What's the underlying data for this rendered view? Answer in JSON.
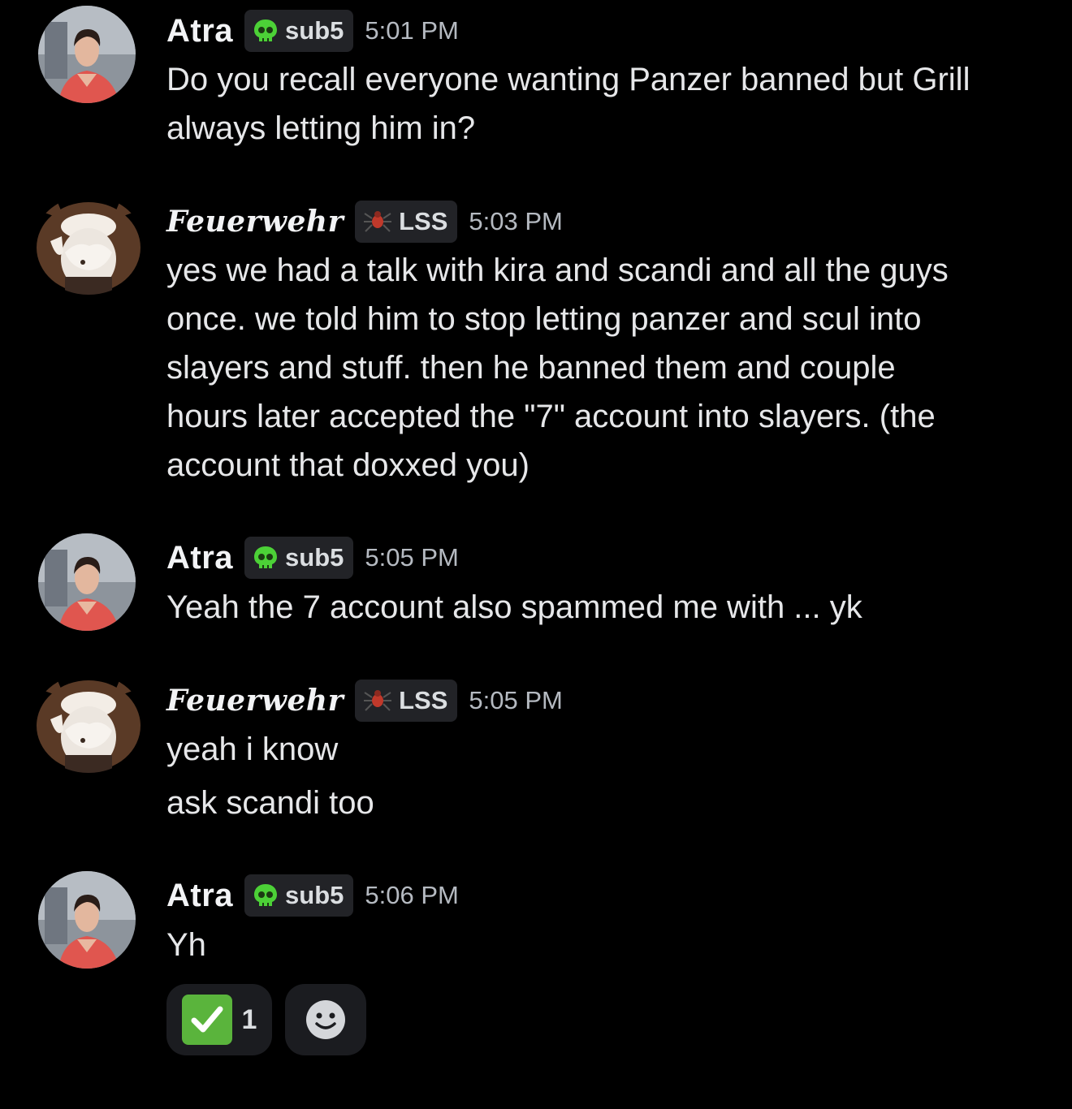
{
  "colors": {
    "background": "#000000",
    "username": "#f2f3f5",
    "timestamp": "#b5bac1",
    "tag_bg": "#222327",
    "sub5_icon": "#4cd137",
    "lss_icon": "#c0392b",
    "check": "#5ab43c"
  },
  "messages": [
    {
      "author": "Atra",
      "tag": {
        "icon": "skull-icon",
        "label": "sub5"
      },
      "time": "5:01 PM",
      "lines": [
        "Do you recall everyone wanting Panzer banned but Grill\nalways letting him in?"
      ]
    },
    {
      "author": "Feuerwehr",
      "tag": {
        "icon": "spider-icon",
        "label": "LSS"
      },
      "time": "5:03 PM",
      "lines": [
        "yes we had a talk with kira and scandi and all the guys\nonce. we told him to stop letting panzer and scul into\nslayers and stuff. then he banned them and couple\nhours later accepted the \"7\" account into slayers. (the\naccount that doxxed you)"
      ]
    },
    {
      "author": "Atra",
      "tag": {
        "icon": "skull-icon",
        "label": "sub5"
      },
      "time": "5:05 PM",
      "lines": [
        "Yeah the 7 account also spammed me with ... yk"
      ]
    },
    {
      "author": "Feuerwehr",
      "tag": {
        "icon": "spider-icon",
        "label": "LSS"
      },
      "time": "5:05 PM",
      "lines": [
        "yeah i know",
        "ask scandi too"
      ]
    },
    {
      "author": "Atra",
      "tag": {
        "icon": "skull-icon",
        "label": "sub5"
      },
      "time": "5:06 PM",
      "lines": [
        "Yh"
      ],
      "reactions": [
        {
          "emoji": "check-mark-icon",
          "count": "1"
        },
        {
          "emoji": "add-reaction-icon"
        }
      ]
    }
  ]
}
